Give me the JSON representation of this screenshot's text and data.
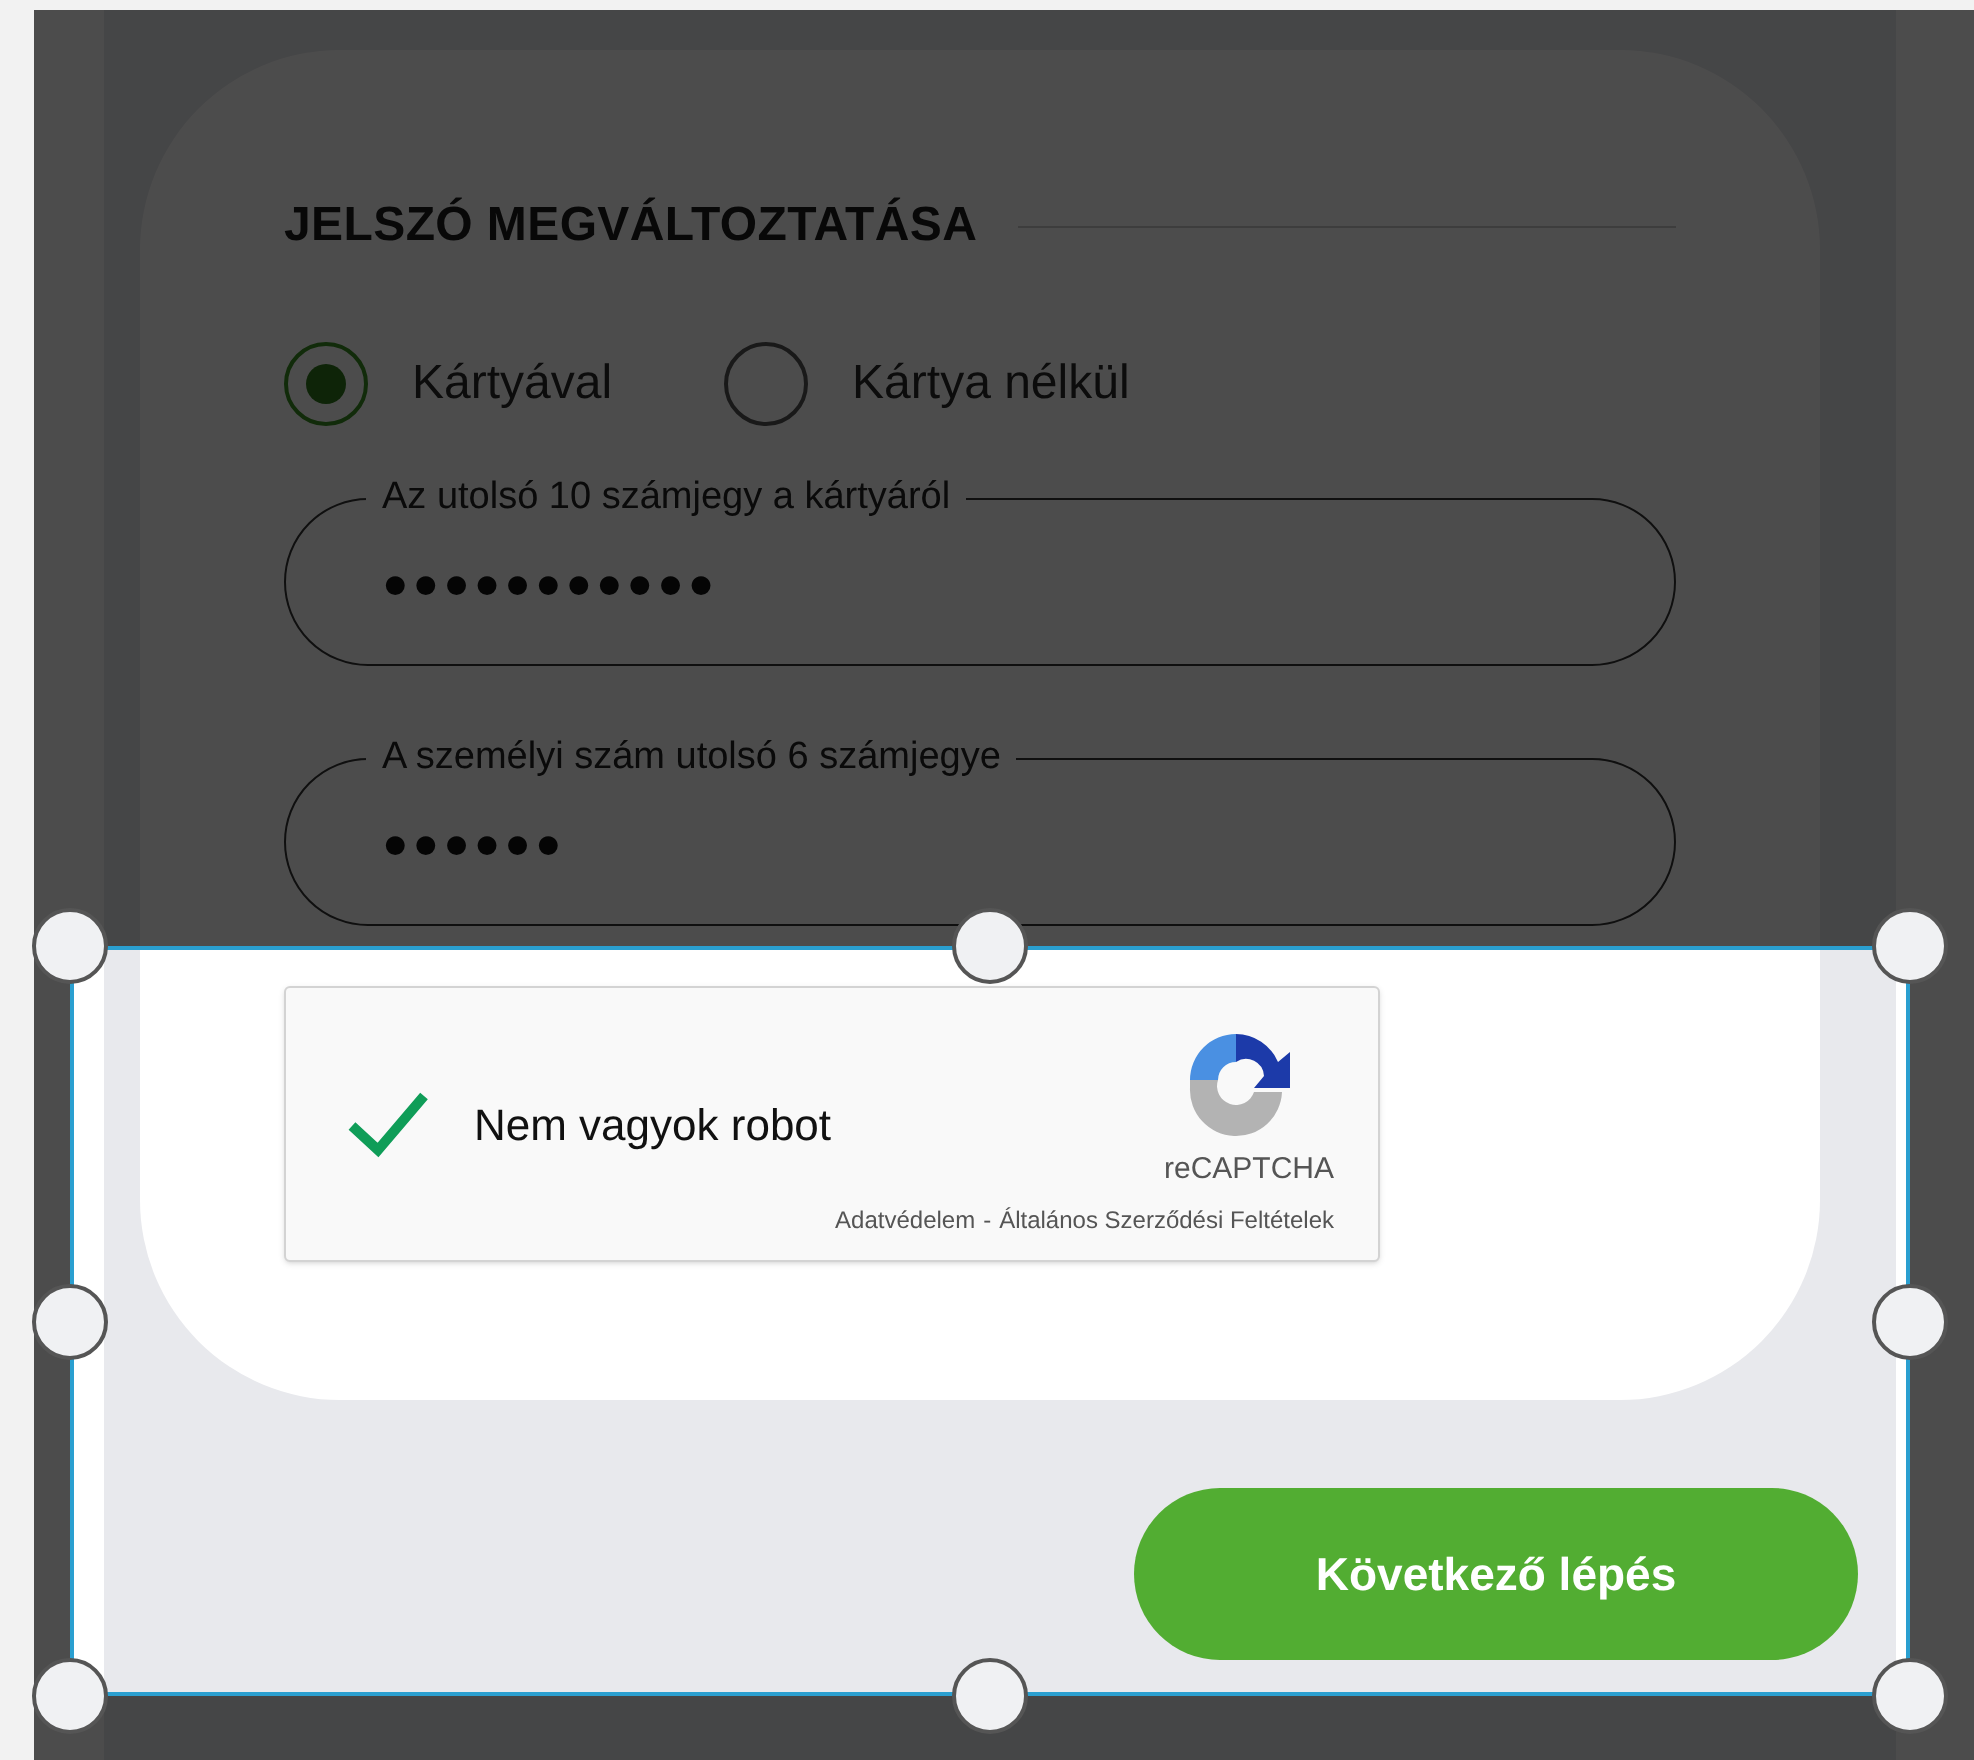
{
  "form": {
    "title": "JELSZÓ MEGVÁLTOZTATÁSA",
    "radios": [
      {
        "label": "Kártyával",
        "selected": true
      },
      {
        "label": "Kártya nélkül",
        "selected": false
      }
    ],
    "fields": [
      {
        "label": "Az utolsó 10 számjegy a kártyáról",
        "value": "●●●●●●●●●●●"
      },
      {
        "label": "A személyi szám utolsó 6 számjegye",
        "value": "●●●●●●"
      }
    ],
    "captcha": {
      "label": "Nem vagyok robot",
      "checked": true,
      "brand": "reCAPTCHA",
      "links": [
        "Adatvédelem",
        "Általános Szerződési Feltételek"
      ],
      "separator": "-"
    }
  },
  "next_button": "Következő lépés"
}
